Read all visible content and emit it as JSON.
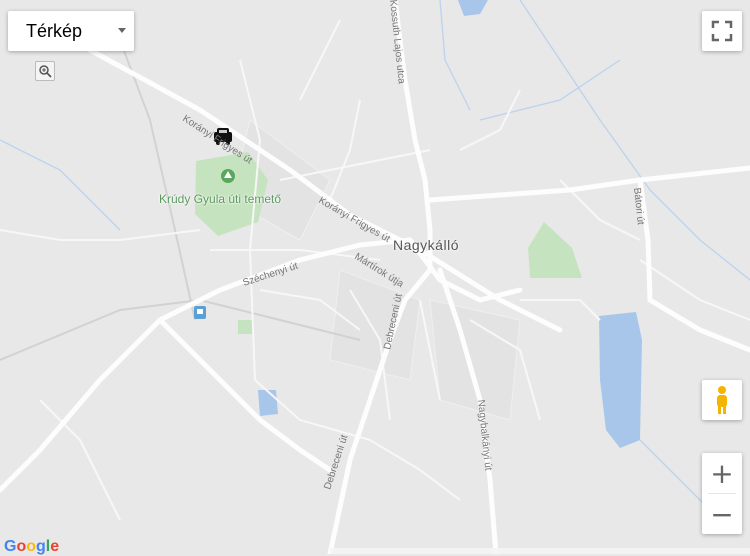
{
  "map_type_label": "Térkép",
  "town_name": "Nagykálló",
  "poi": {
    "cemetery": "Krúdy Gyula úti temető"
  },
  "streets": {
    "koranyi_1": "Korányi Frigyes út",
    "koranyi_2": "Korányi Frigyes út",
    "martirok": "Mártírok útja",
    "szechenyi": "Széchenyi út",
    "debreceni_1": "Debreceni út",
    "debreceni_2": "Debreceni út",
    "kossuth": "Kossuth Lajos utca",
    "baloti": "Bátori út",
    "nagybalkanyi": "Nagybalkányi út"
  },
  "google_logo": "Google",
  "zoom_in_label": "+",
  "zoom_out_label": "−",
  "colors": {
    "road": "#fdfdfd",
    "park": "#c6e3bf",
    "water": "#a7c6ea",
    "land": "#e8e8e8"
  }
}
